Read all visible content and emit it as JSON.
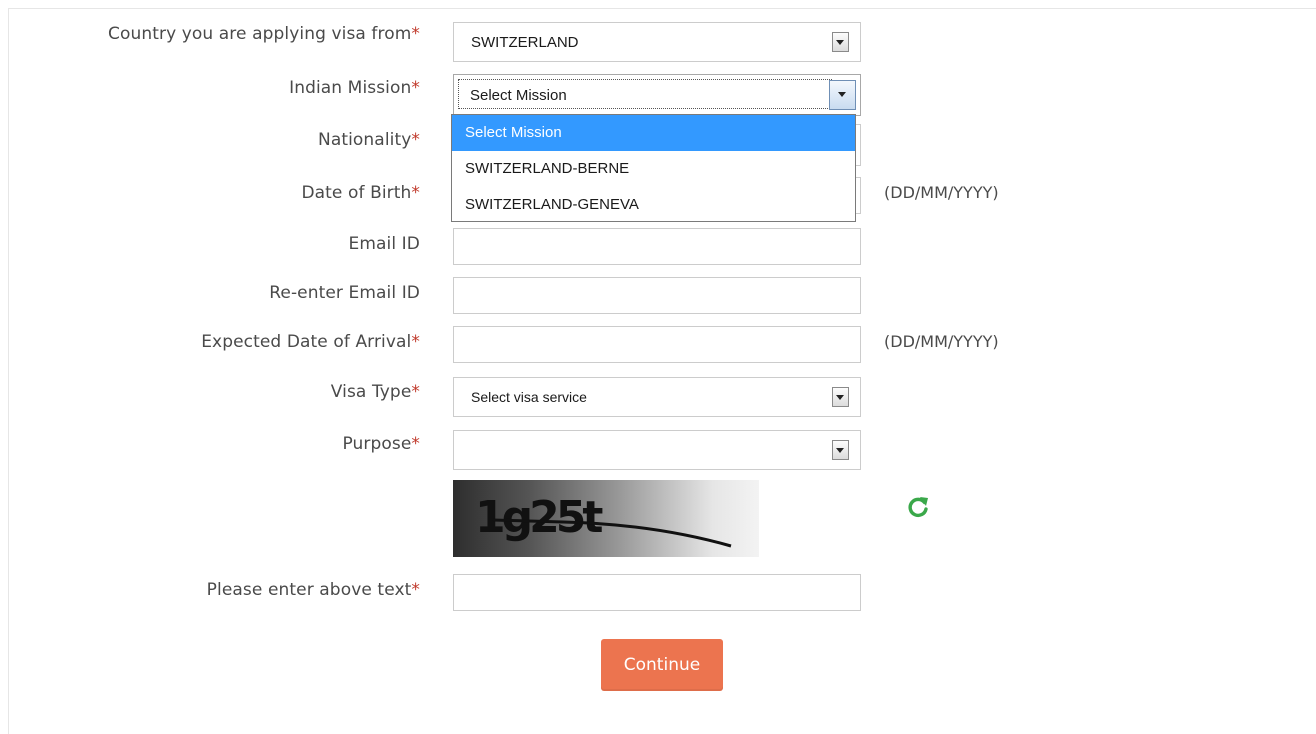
{
  "form": {
    "required_marker": "*",
    "country": {
      "label": "Country you are applying visa from",
      "value": "SWITZERLAND"
    },
    "mission": {
      "label": "Indian Mission",
      "value": "Select Mission",
      "options": [
        "Select Mission",
        "SWITZERLAND-BERNE",
        "SWITZERLAND-GENEVA"
      ]
    },
    "nationality": {
      "label": "Nationality"
    },
    "dob": {
      "label": "Date of Birth",
      "hint": "(DD/MM/YYYY)",
      "value": ""
    },
    "email": {
      "label": "Email ID",
      "value": ""
    },
    "email_confirm": {
      "label": "Re-enter Email ID",
      "value": ""
    },
    "arrival": {
      "label": "Expected Date of Arrival",
      "hint": "(DD/MM/YYYY)",
      "value": ""
    },
    "visa_type": {
      "label": "Visa Type",
      "value": "Select visa service"
    },
    "purpose": {
      "label": "Purpose",
      "value": ""
    },
    "captcha": {
      "text": "1g25t",
      "input_label": "Please enter above text",
      "value": ""
    },
    "continue_label": "Continue"
  },
  "colors": {
    "required": "#c0392b",
    "button": "#ec744f",
    "dropdown_highlight": "#3399ff",
    "refresh_icon": "#3aa84a"
  },
  "icons": {
    "refresh": "refresh-icon",
    "dropdown": "chevron-down-icon"
  }
}
